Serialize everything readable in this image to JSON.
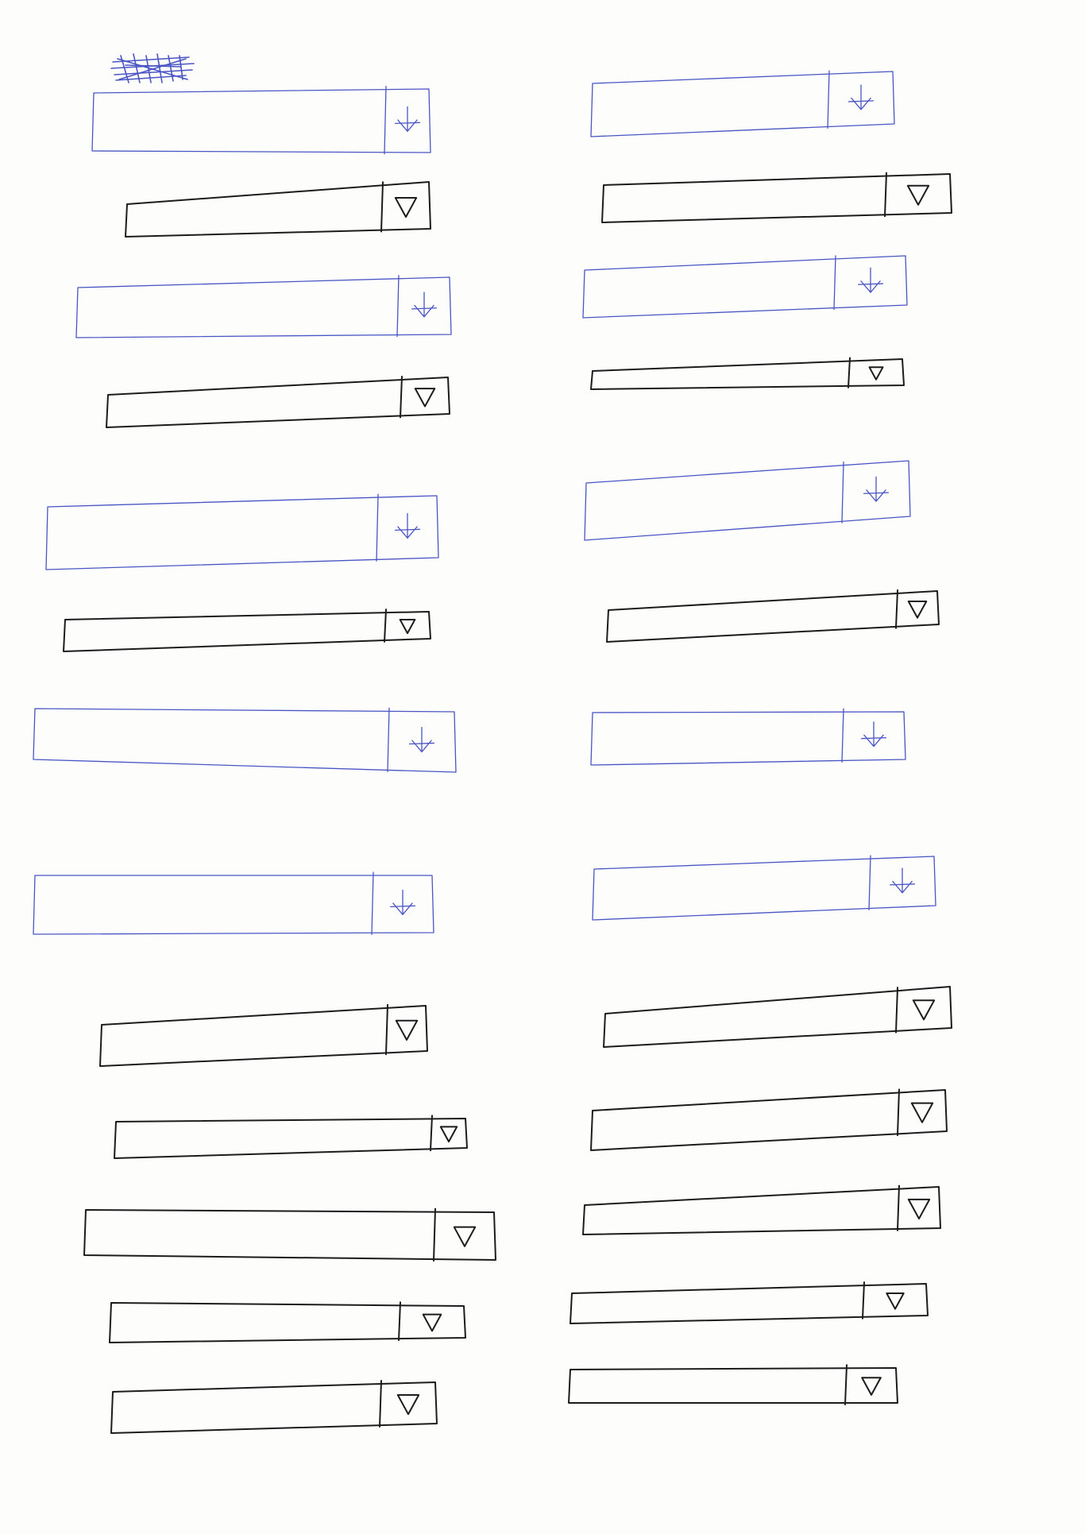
{
  "sheet": {
    "paper_color": "#fdfdfc",
    "ink_blue": "#4a55c4",
    "ink_black": "#1c1c1c"
  },
  "sketch": {
    "crossed_out_label": "",
    "dropdowns": [
      {
        "column": "left",
        "ink": "blue",
        "icon": "down-arrow-icon"
      },
      {
        "column": "left",
        "ink": "black",
        "icon": "triangle-down-icon"
      },
      {
        "column": "left",
        "ink": "blue",
        "icon": "down-arrow-icon"
      },
      {
        "column": "left",
        "ink": "black",
        "icon": "triangle-down-icon"
      },
      {
        "column": "left",
        "ink": "blue",
        "icon": "down-arrow-icon"
      },
      {
        "column": "left",
        "ink": "black",
        "icon": "triangle-down-icon"
      },
      {
        "column": "left",
        "ink": "blue",
        "icon": "down-arrow-icon"
      },
      {
        "column": "left",
        "ink": "blue",
        "icon": "down-arrow-icon"
      },
      {
        "column": "left",
        "ink": "black",
        "icon": "triangle-down-icon"
      },
      {
        "column": "left",
        "ink": "black",
        "icon": "triangle-down-icon"
      },
      {
        "column": "left",
        "ink": "black",
        "icon": "triangle-down-icon"
      },
      {
        "column": "left",
        "ink": "black",
        "icon": "triangle-down-icon"
      },
      {
        "column": "left",
        "ink": "black",
        "icon": "triangle-down-icon"
      },
      {
        "column": "right",
        "ink": "blue",
        "icon": "down-arrow-icon"
      },
      {
        "column": "right",
        "ink": "black",
        "icon": "triangle-down-icon"
      },
      {
        "column": "right",
        "ink": "blue",
        "icon": "down-arrow-icon"
      },
      {
        "column": "right",
        "ink": "black",
        "icon": "triangle-down-icon"
      },
      {
        "column": "right",
        "ink": "blue",
        "icon": "down-arrow-icon"
      },
      {
        "column": "right",
        "ink": "black",
        "icon": "triangle-down-icon"
      },
      {
        "column": "right",
        "ink": "blue",
        "icon": "down-arrow-icon"
      },
      {
        "column": "right",
        "ink": "blue",
        "icon": "down-arrow-icon"
      },
      {
        "column": "right",
        "ink": "black",
        "icon": "triangle-down-icon"
      },
      {
        "column": "right",
        "ink": "black",
        "icon": "triangle-down-icon"
      },
      {
        "column": "right",
        "ink": "black",
        "icon": "triangle-down-icon"
      },
      {
        "column": "right",
        "ink": "black",
        "icon": "triangle-down-icon"
      },
      {
        "column": "right",
        "ink": "black",
        "icon": "triangle-down-icon"
      }
    ]
  }
}
